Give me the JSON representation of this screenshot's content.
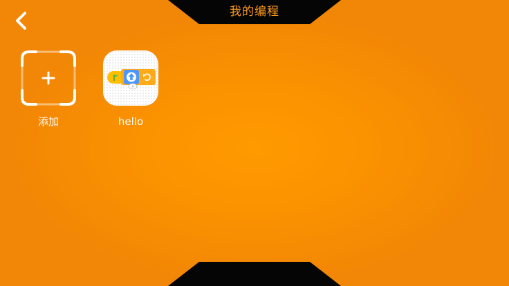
{
  "header": {
    "title": "我的编程",
    "back_icon": "chevron-left-icon"
  },
  "tiles": [
    {
      "label": "添加",
      "icon": "plus-icon"
    },
    {
      "label": "hello",
      "icon": "project-blocks-thumbnail"
    }
  ],
  "colors": {
    "background": "#fb9200",
    "tab": "#050505",
    "title": "#ff9a1a",
    "text": "#ffffff"
  }
}
